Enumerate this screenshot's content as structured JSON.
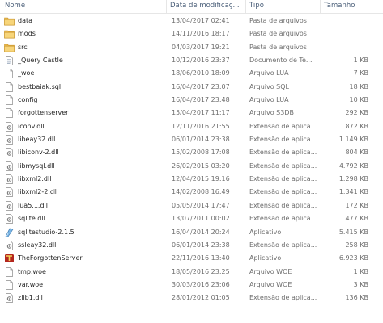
{
  "columns": {
    "name": "Nome",
    "date": "Data de modificaç...",
    "type": "Tipo",
    "size": "Tamanho"
  },
  "files": [
    {
      "name": "data",
      "date": "13/04/2017 02:41",
      "type": "Pasta de arquivos",
      "size": "",
      "icon": "folder-icon"
    },
    {
      "name": "mods",
      "date": "14/11/2016 18:17",
      "type": "Pasta de arquivos",
      "size": "",
      "icon": "folder-icon"
    },
    {
      "name": "src",
      "date": "04/03/2017 19:21",
      "type": "Pasta de arquivos",
      "size": "",
      "icon": "folder-icon"
    },
    {
      "name": "_Query Castle",
      "date": "10/12/2016 23:37",
      "type": "Documento de Te...",
      "size": "1 KB",
      "icon": "text-file-icon"
    },
    {
      "name": "_woe",
      "date": "18/06/2010 18:09",
      "type": "Arquivo LUA",
      "size": "7 KB",
      "icon": "file-icon"
    },
    {
      "name": "bestbaiak.sql",
      "date": "16/04/2017 23:07",
      "type": "Arquivo SQL",
      "size": "18 KB",
      "icon": "file-icon"
    },
    {
      "name": "config",
      "date": "16/04/2017 23:48",
      "type": "Arquivo LUA",
      "size": "10 KB",
      "icon": "file-icon"
    },
    {
      "name": "forgottenserver",
      "date": "15/04/2017 11:17",
      "type": "Arquivo S3DB",
      "size": "292 KB",
      "icon": "file-icon"
    },
    {
      "name": "iconv.dll",
      "date": "12/11/2016 21:55",
      "type": "Extensão de aplica...",
      "size": "872 KB",
      "icon": "dll-icon"
    },
    {
      "name": "libeay32.dll",
      "date": "06/01/2014 23:38",
      "type": "Extensão de aplica...",
      "size": "1.149 KB",
      "icon": "dll-icon"
    },
    {
      "name": "libiconv-2.dll",
      "date": "15/02/2008 17:08",
      "type": "Extensão de aplica...",
      "size": "804 KB",
      "icon": "dll-icon"
    },
    {
      "name": "libmysql.dll",
      "date": "26/02/2015 03:20",
      "type": "Extensão de aplica...",
      "size": "4.792 KB",
      "icon": "dll-icon"
    },
    {
      "name": "libxml2.dll",
      "date": "12/04/2015 19:16",
      "type": "Extensão de aplica...",
      "size": "1.298 KB",
      "icon": "dll-icon"
    },
    {
      "name": "libxml2-2.dll",
      "date": "14/02/2008 16:49",
      "type": "Extensão de aplica...",
      "size": "1.341 KB",
      "icon": "dll-icon"
    },
    {
      "name": "lua5.1.dll",
      "date": "05/05/2014 17:47",
      "type": "Extensão de aplica...",
      "size": "172 KB",
      "icon": "dll-icon"
    },
    {
      "name": "sqlite.dll",
      "date": "13/07/2011 00:02",
      "type": "Extensão de aplica...",
      "size": "477 KB",
      "icon": "dll-icon"
    },
    {
      "name": "sqlitestudio-2.1.5",
      "date": "16/04/2014 20:24",
      "type": "Aplicativo",
      "size": "5.415 KB",
      "icon": "sqlitestudio-app-icon"
    },
    {
      "name": "ssleay32.dll",
      "date": "06/01/2014 23:38",
      "type": "Extensão de aplica...",
      "size": "258 KB",
      "icon": "dll-icon"
    },
    {
      "name": "TheForgottenServer",
      "date": "22/11/2016 13:40",
      "type": "Aplicativo",
      "size": "6.923 KB",
      "icon": "tfs-app-icon"
    },
    {
      "name": "tmp.woe",
      "date": "18/05/2016 23:25",
      "type": "Arquivo WOE",
      "size": "1 KB",
      "icon": "file-icon"
    },
    {
      "name": "var.woe",
      "date": "30/03/2016 23:06",
      "type": "Arquivo WOE",
      "size": "3 KB",
      "icon": "file-icon"
    },
    {
      "name": "zlib1.dll",
      "date": "28/01/2012 01:05",
      "type": "Extensão de aplica...",
      "size": "136 KB",
      "icon": "dll-icon"
    }
  ]
}
